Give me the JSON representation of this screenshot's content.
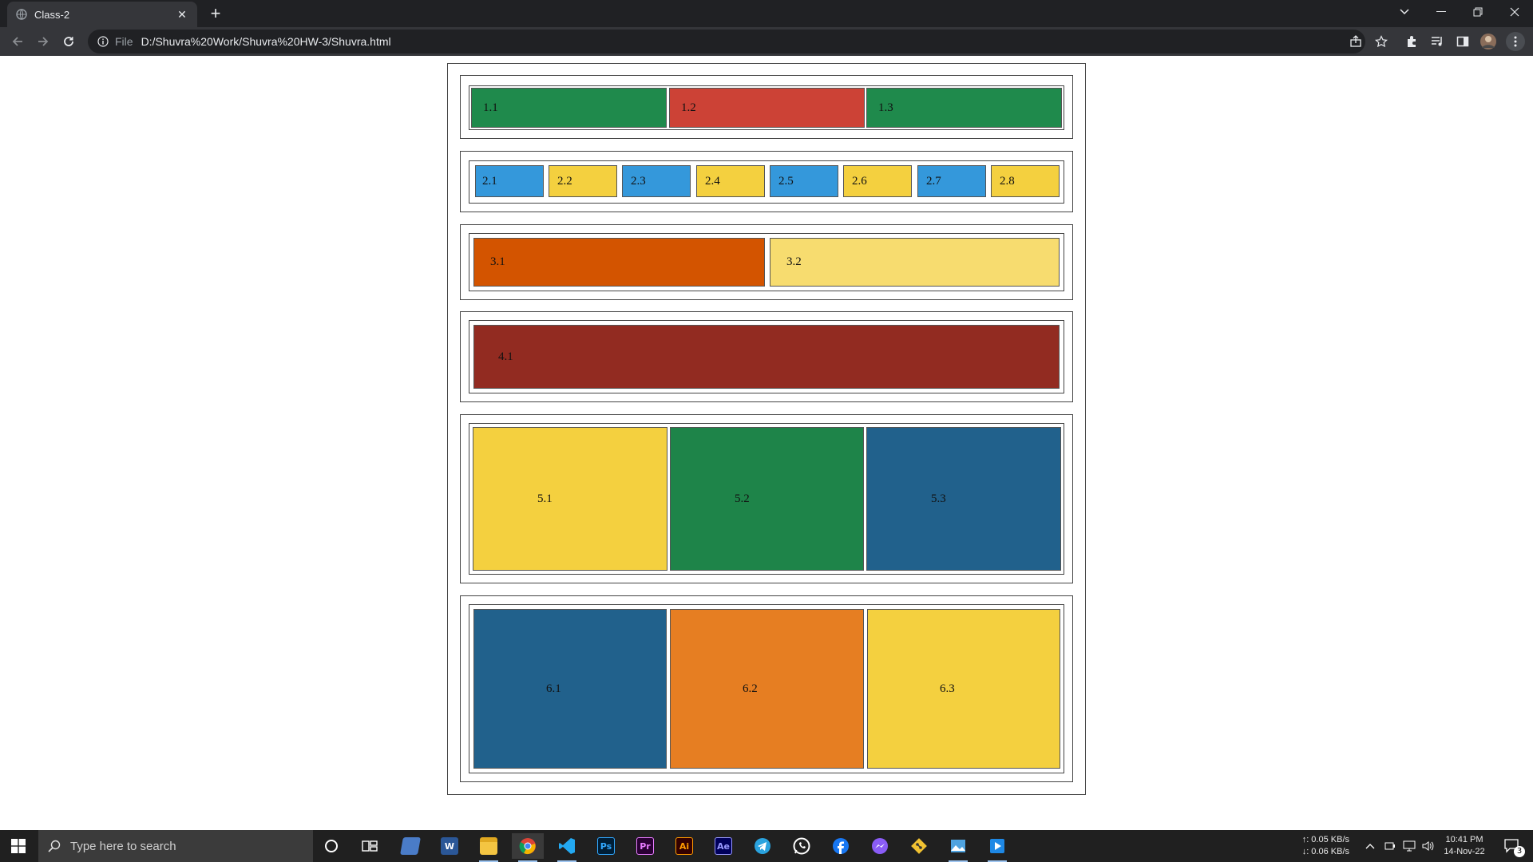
{
  "browser": {
    "tab_title": "Class-2",
    "address_scheme": "File",
    "address_url": "D:/Shuvra%20Work/Shuvra%20HW-3/Shuvra.html"
  },
  "sections": [
    {
      "boxes": [
        {
          "label": "1.1",
          "color": "#1f8a4c"
        },
        {
          "label": "1.2",
          "color": "#cc4236"
        },
        {
          "label": "1.3",
          "color": "#1f8a4c"
        }
      ]
    },
    {
      "boxes": [
        {
          "label": "2.1",
          "color": "#3498db"
        },
        {
          "label": "2.2",
          "color": "#f4d03f"
        },
        {
          "label": "2.3",
          "color": "#3498db"
        },
        {
          "label": "2.4",
          "color": "#f4d03f"
        },
        {
          "label": "2.5",
          "color": "#3498db"
        },
        {
          "label": "2.6",
          "color": "#f4d03f"
        },
        {
          "label": "2.7",
          "color": "#3498db"
        },
        {
          "label": "2.8",
          "color": "#f4d03f"
        }
      ]
    },
    {
      "boxes": [
        {
          "label": "3.1",
          "color": "#d35400"
        },
        {
          "label": "3.2",
          "color": "#f7dc6f"
        }
      ]
    },
    {
      "boxes": [
        {
          "label": "4.1",
          "color": "#922b21"
        }
      ]
    },
    {
      "boxes": [
        {
          "label": "5.1",
          "color": "#f4d03f"
        },
        {
          "label": "5.2",
          "color": "#1e8449"
        },
        {
          "label": "5.3",
          "color": "#21618c"
        }
      ]
    },
    {
      "boxes": [
        {
          "label": "6.1",
          "color": "#21618c"
        },
        {
          "label": "6.2",
          "color": "#e67e22"
        },
        {
          "label": "6.3",
          "color": "#f4d03f"
        }
      ]
    }
  ],
  "taskbar": {
    "search_placeholder": "Type here to search",
    "net_up": "↑: 0.05 KB/s",
    "net_down": "↓: 0.06 KB/s",
    "time": "10:41 PM",
    "date": "14-Nov-22",
    "notification_count": "3",
    "apps": [
      "cortana-icon",
      "task-view-icon",
      "file-app-icon",
      "word-icon",
      "file-explorer-icon",
      "chrome-icon",
      "vscode-icon",
      "photoshop-icon",
      "premiere-icon",
      "illustrator-icon",
      "after-effects-icon",
      "telegram-icon",
      "whatsapp-icon",
      "facebook-icon",
      "messenger-icon",
      "git-icon",
      "photos-icon",
      "media-player-icon"
    ]
  }
}
